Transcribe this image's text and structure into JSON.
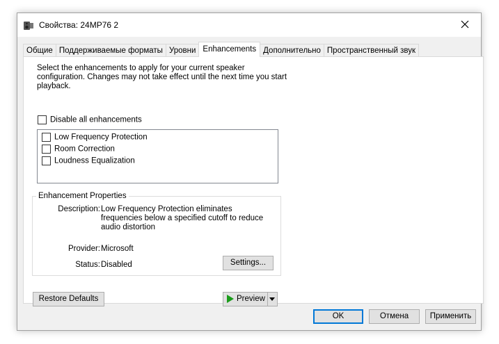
{
  "window": {
    "title": "Свойства: 24MP76 2",
    "title_icon": "speaker-icon",
    "close_icon": "close-icon"
  },
  "tabs": [
    {
      "label": "Общие",
      "active": false
    },
    {
      "label": "Поддерживаемые форматы",
      "active": false
    },
    {
      "label": "Уровни",
      "active": false
    },
    {
      "label": "Enhancements",
      "active": true
    },
    {
      "label": "Дополнительно",
      "active": false
    },
    {
      "label": "Пространственный звук",
      "active": false
    }
  ],
  "enhancements": {
    "description": "Select the enhancements to apply for your current speaker configuration. Changes may not take effect until the next time you start playback.",
    "disable_all_label": "Disable all enhancements",
    "disable_all_checked": false,
    "items": [
      {
        "label": "Low Frequency Protection",
        "checked": false
      },
      {
        "label": "Room Correction",
        "checked": false
      },
      {
        "label": "Loudness Equalization",
        "checked": false
      }
    ]
  },
  "properties": {
    "title": "Enhancement Properties",
    "description_label": "Description:",
    "description_value": "Low Frequency Protection eliminates frequencies below a specified cutoff to reduce audio distortion",
    "provider_label": "Provider:",
    "provider_value": "Microsoft",
    "status_label": "Status:",
    "status_value": "Disabled",
    "settings_button": "Settings..."
  },
  "buttons": {
    "restore_defaults": "Restore Defaults",
    "preview": "Preview",
    "ok": "OK",
    "cancel": "Отмена",
    "apply": "Применить"
  },
  "colors": {
    "accent": "#0078d7",
    "preview_play": "#1a9c1a"
  }
}
